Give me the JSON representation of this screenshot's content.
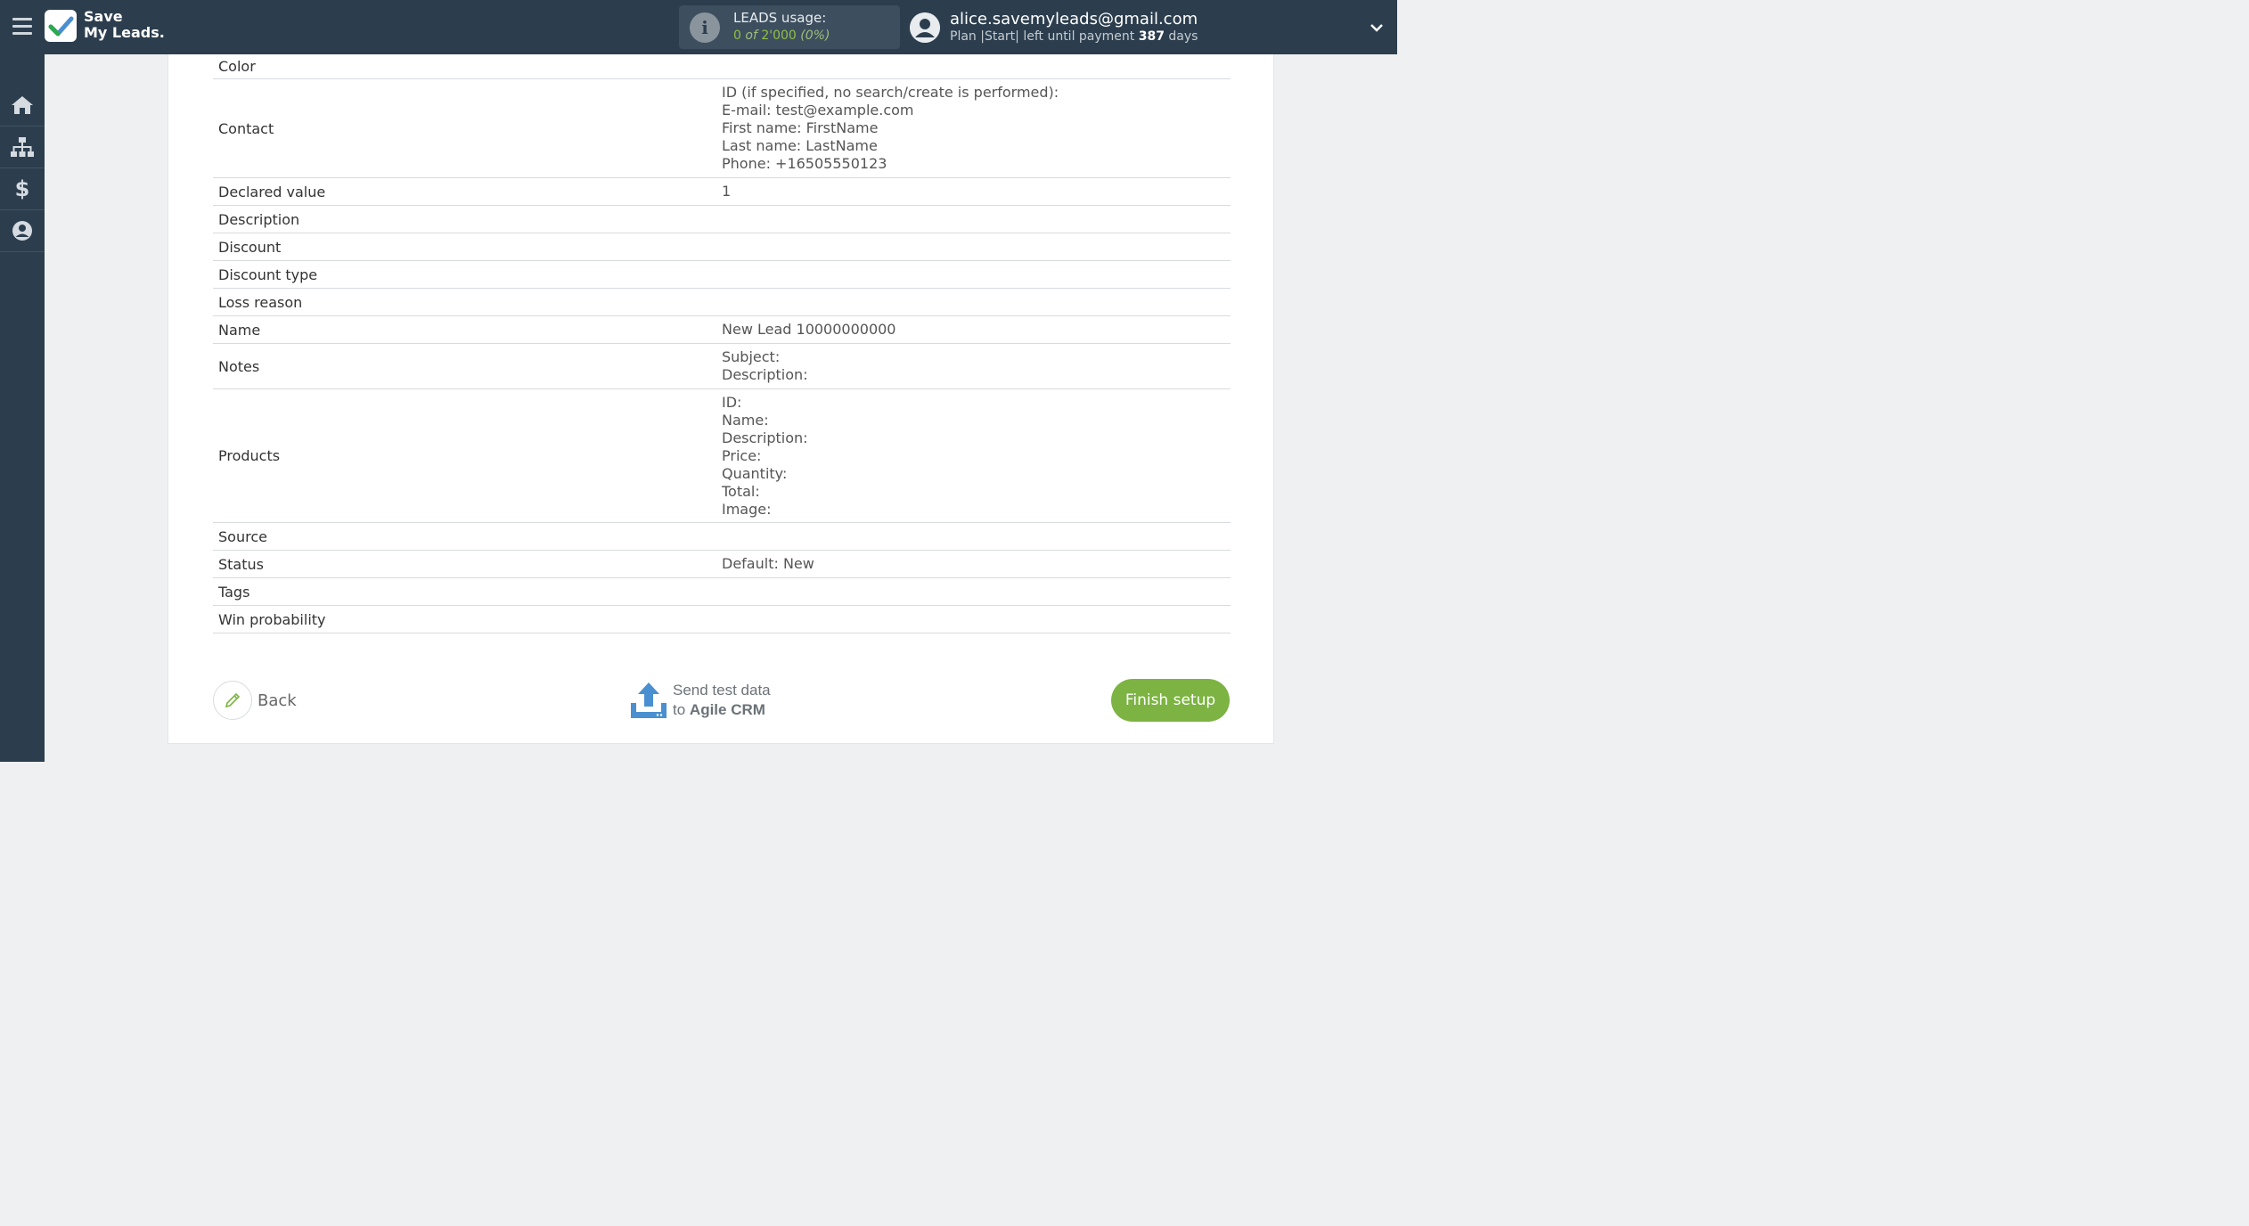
{
  "header": {
    "logo_line1": "Save",
    "logo_line2": "My Leads.",
    "leads_title": "LEADS usage:",
    "leads_used": "0",
    "leads_of": "of",
    "leads_total": "2'000",
    "leads_percent": "(0%)",
    "user_email": "alice.savemyleads@gmail.com",
    "plan_prefix": "Plan |Start| left until payment",
    "plan_days": "387",
    "plan_suffix": "days"
  },
  "sidebar": {
    "items": [
      {
        "icon": "home-icon"
      },
      {
        "icon": "sitemap-icon"
      },
      {
        "icon": "dollar-icon"
      },
      {
        "icon": "user-icon"
      }
    ]
  },
  "fields": [
    {
      "label": "Color",
      "values": []
    },
    {
      "label": "Contact",
      "values": [
        "ID (if specified, no search/create is performed):",
        "E-mail: test@example.com",
        "First name: FirstName",
        "Last name: LastName",
        "Phone: +16505550123"
      ]
    },
    {
      "label": "Declared value",
      "values": [
        "1"
      ]
    },
    {
      "label": "Description",
      "values": []
    },
    {
      "label": "Discount",
      "values": []
    },
    {
      "label": "Discount type",
      "values": []
    },
    {
      "label": "Loss reason",
      "values": []
    },
    {
      "label": "Name",
      "values": [
        "New Lead 10000000000"
      ]
    },
    {
      "label": "Notes",
      "values": [
        "Subject:",
        "Description:"
      ]
    },
    {
      "label": "Products",
      "values": [
        "ID:",
        "Name:",
        "Description:",
        "Price:",
        "Quantity:",
        "Total:",
        "Image:"
      ]
    },
    {
      "label": "Source",
      "values": []
    },
    {
      "label": "Status",
      "values": [
        "Default: New"
      ]
    },
    {
      "label": "Tags",
      "values": []
    },
    {
      "label": "Win probability",
      "values": []
    }
  ],
  "actions": {
    "back_label": "Back",
    "send_line1": "Send test data",
    "send_line2_prefix": "to",
    "send_line2_target": "Agile CRM",
    "finish_label": "Finish setup"
  },
  "colors": {
    "topbar": "#2c3e4e",
    "accent": "#7cb342",
    "send_icon": "#4a8fd0"
  }
}
